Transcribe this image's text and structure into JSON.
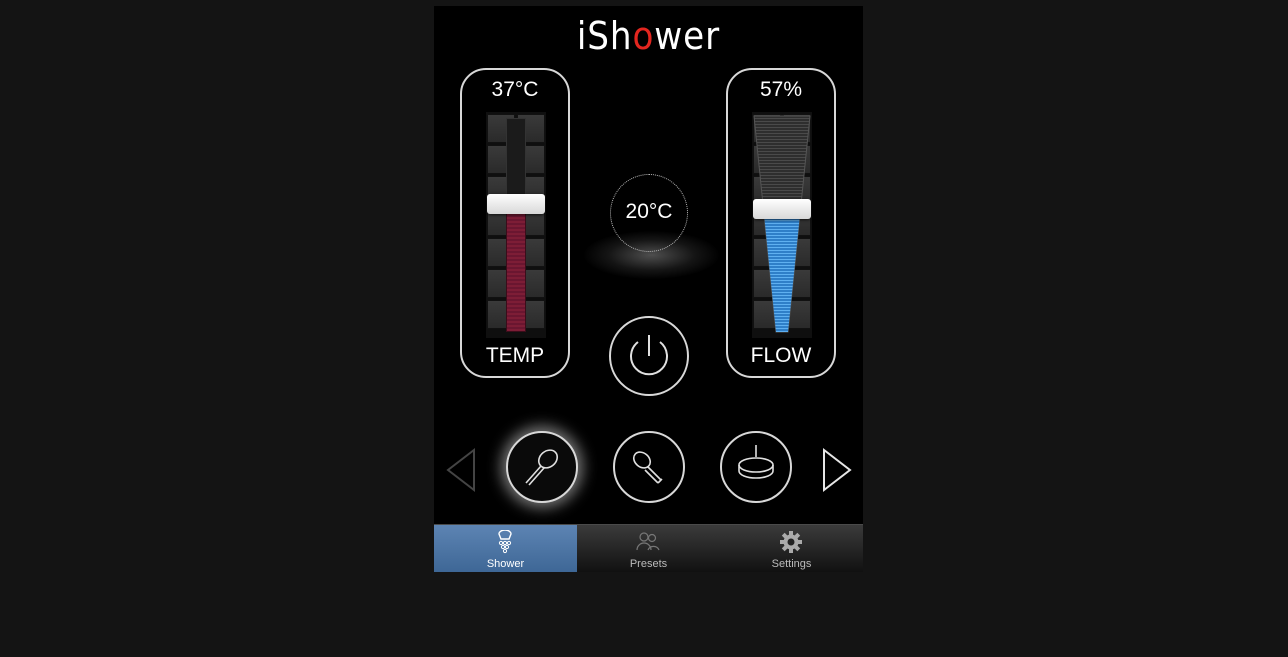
{
  "app": {
    "title_prefix": "iSh",
    "title_accent": "o",
    "title_suffix": "wer"
  },
  "temperature": {
    "value_text": "37°C",
    "label": "TEMP",
    "level_fraction": 0.6
  },
  "flow": {
    "value_text": "57%",
    "label": "FLOW",
    "level_fraction": 0.57
  },
  "ambient": {
    "value_text": "20°C",
    "icon": "cloud-icon"
  },
  "power": {
    "icon": "power-icon"
  },
  "shower_heads": [
    {
      "icon": "handheld-shower-icon",
      "selected": true
    },
    {
      "icon": "angled-shower-icon",
      "selected": false
    },
    {
      "icon": "overhead-shower-icon",
      "selected": false
    }
  ],
  "tabs": [
    {
      "label": "Shower",
      "icon": "shower-icon",
      "active": true
    },
    {
      "label": "Presets",
      "icon": "users-icon",
      "active": false
    },
    {
      "label": "Settings",
      "icon": "gear-icon",
      "active": false
    }
  ],
  "colors": {
    "accent_red": "#e3261f",
    "temp_fill": "#7d1d36",
    "flow_fill": "#3a8fd8",
    "active_tab": "#4e77a6"
  }
}
